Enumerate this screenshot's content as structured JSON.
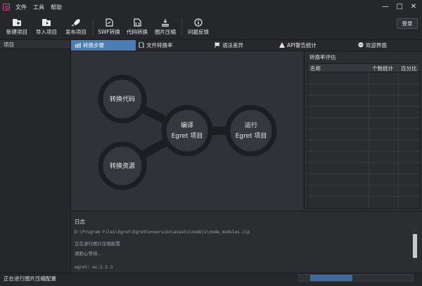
{
  "menu": [
    "文件",
    "工具",
    "帮助"
  ],
  "window": {
    "minimize": "—",
    "maximize": "□",
    "close": "✕"
  },
  "toolbar": {
    "items": [
      {
        "label": "新建项目",
        "icon": "new-project-icon"
      },
      {
        "label": "导入项目",
        "icon": "import-project-icon"
      },
      {
        "label": "发布项目",
        "icon": "publish-rocket-icon"
      },
      {
        "label": "SWF转换",
        "icon": "swf-convert-icon"
      },
      {
        "label": "代码转换",
        "icon": "code-convert-icon"
      },
      {
        "label": "图片压缩",
        "icon": "image-compress-icon"
      },
      {
        "label": "问题反馈",
        "icon": "info-icon"
      }
    ],
    "login": "登录"
  },
  "left_panel": {
    "title": "项目"
  },
  "tabs": [
    {
      "label": "转换步骤",
      "active": true
    },
    {
      "label": "文件转换率",
      "active": false
    },
    {
      "label": "语法差异",
      "active": false
    },
    {
      "label": "API警告统计",
      "active": false
    },
    {
      "label": "欢迎界面",
      "active": false
    }
  ],
  "diagram": {
    "nodes": {
      "convert_code": "转换代码",
      "convert_resources": "转换资源",
      "compile_line1": "编译",
      "compile_line2": "Egret 项目",
      "run_line1": "运行",
      "run_line2": "Egret 项目"
    }
  },
  "stats": {
    "title": "转换率评估",
    "columns": [
      "名称",
      "个数统计",
      "百分比"
    ]
  },
  "log": {
    "title": "日志",
    "lines": [
      "D:\\Program Files\\Egret\\EgretConversion\\assets\\nodejs\\node_modules.zip",
      "正在进行图片压缩配置",
      "请耐心等待..."
    ],
    "version": "egret:  ec:2.5.3"
  },
  "status": {
    "text": "正在进行图片压缩配置",
    "progress_fraction": 0.37
  },
  "colors": {
    "accent": "#4a7fb5",
    "logo": "#d9468e",
    "node_fill": "#35393e",
    "node_ring": "#1c1e21"
  }
}
